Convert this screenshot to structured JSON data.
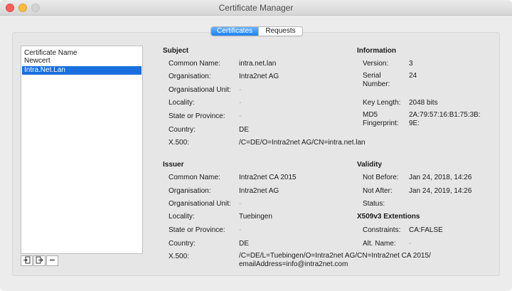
{
  "window": {
    "title": "Certificate Manager"
  },
  "tabs": {
    "certificates": "Certificates",
    "requests": "Requests"
  },
  "list": {
    "header": "Certificate Name",
    "items": [
      {
        "label": "Newcert"
      },
      {
        "label": "Intra.Net.Lan",
        "selected": true
      }
    ]
  },
  "toolbar": {
    "import_icon": "import-icon",
    "export_icon": "export-icon",
    "remove_label": "–"
  },
  "subject": {
    "title": "Subject",
    "common_name_label": "Common Name:",
    "common_name": "intra.net.lan",
    "organisation_label": "Organisation:",
    "organisation": "Intra2net AG",
    "org_unit_label": "Organisational Unit:",
    "org_unit": "-",
    "locality_label": "Locality:",
    "locality": "-",
    "state_label": "State or Province:",
    "state": "-",
    "country_label": "Country:",
    "country": "DE",
    "x500_label": "X.500:",
    "x500": "/C=DE/O=Intra2net AG/CN=intra.net.lan"
  },
  "information": {
    "title": "Information",
    "version_label": "Version:",
    "version": "3",
    "serial_label": "Serial Number:",
    "serial": "24",
    "key_length_label": "Key Length:",
    "key_length": "2048 bits",
    "md5_label": "MD5 Fingerprint:",
    "md5": "2A:79:57:16:B1:75:3B: 9E:"
  },
  "issuer": {
    "title": "Issuer",
    "common_name_label": "Common Name:",
    "common_name": "Intra2net CA 2015",
    "organisation_label": "Organisation:",
    "organisation": "Intra2net AG",
    "org_unit_label": "Organisational Unit:",
    "org_unit": "-",
    "locality_label": "Locality:",
    "locality": "Tuebingen",
    "state_label": "State or Province:",
    "state": "-",
    "country_label": "Country:",
    "country": "DE",
    "x500_label": "X.500:",
    "x500": "/C=DE/L=Tuebingen/O=Intra2net AG/CN=Intra2net CA 2015/ emailAddress=info@intra2net.com"
  },
  "validity": {
    "title": "Validity",
    "not_before_label": "Not Before:",
    "not_before": "Jan 24, 2018, 14:26",
    "not_after_label": "Not After:",
    "not_after": "Jan 24, 2019, 14:26",
    "status_label": "Status:",
    "status": ""
  },
  "extensions": {
    "title": "X509v3 Extentions",
    "constraints_label": "Constraints:",
    "constraints": "CA:FALSE",
    "alt_name_label": "Alt. Name:",
    "alt_name": "-"
  },
  "colors": {
    "accent": "#1a82fb",
    "selection": "#1a6fdf"
  }
}
